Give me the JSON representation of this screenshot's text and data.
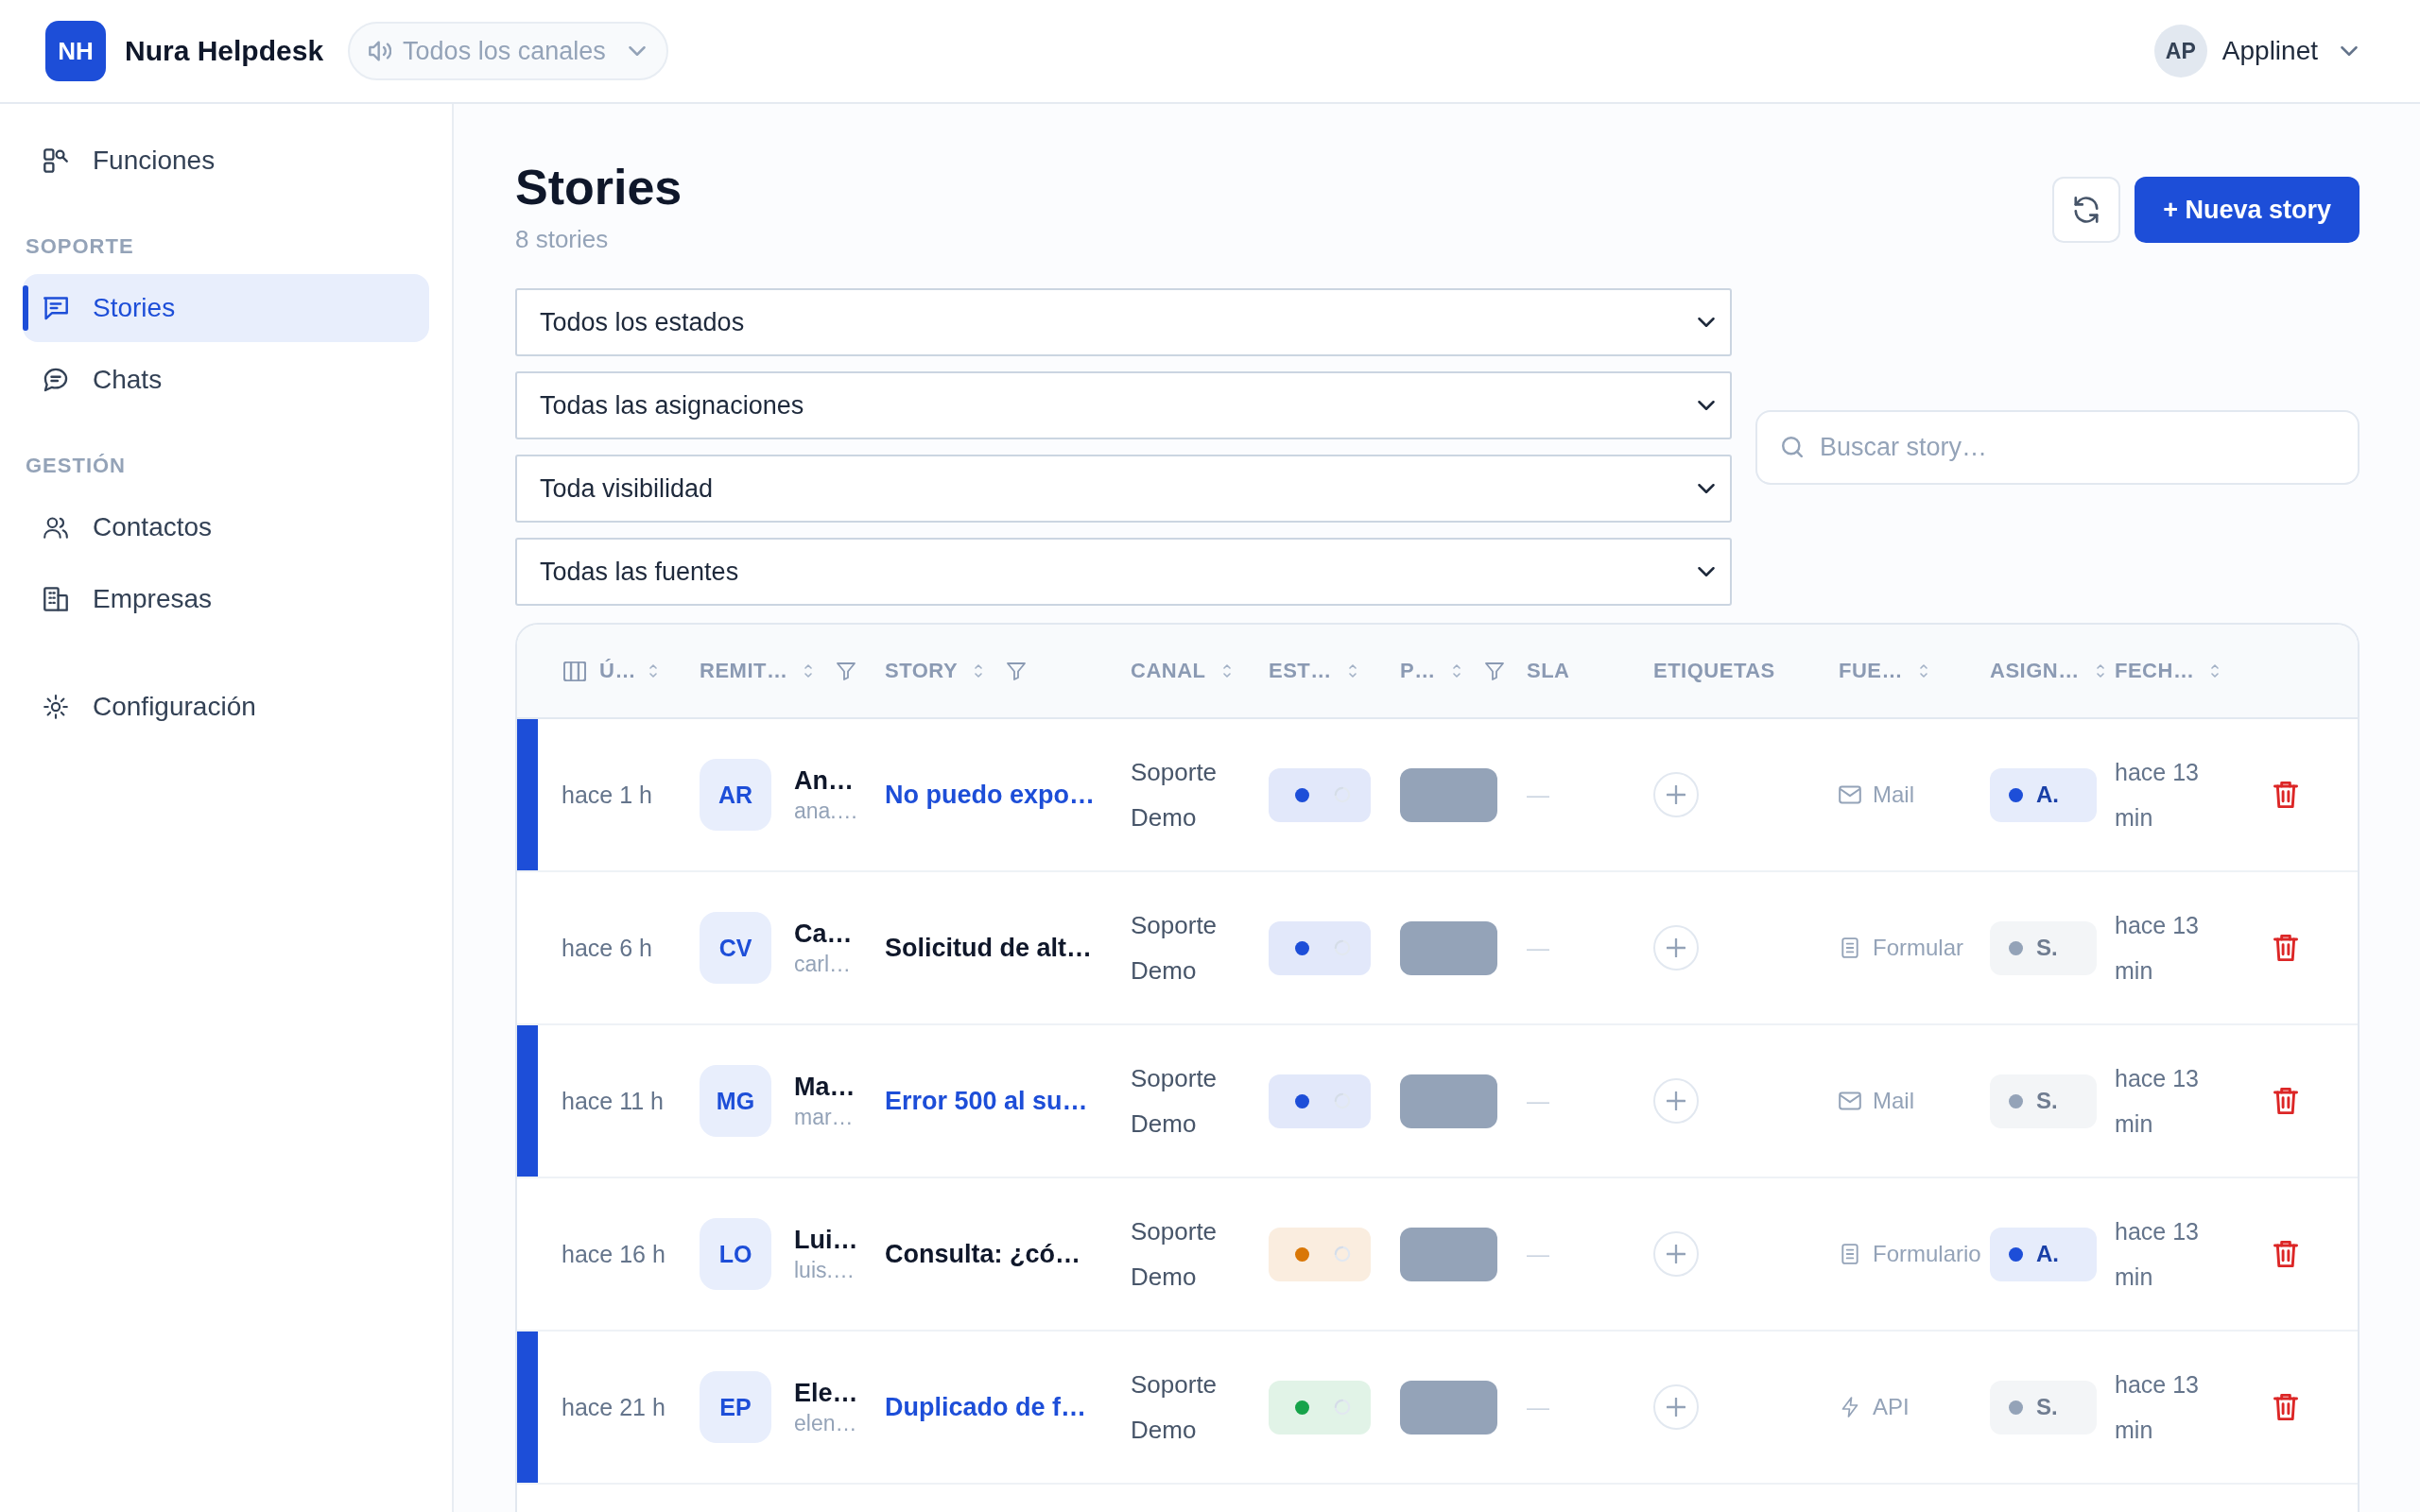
{
  "topbar": {
    "logo": "NH",
    "app_name": "Nura Helpdesk",
    "channel_select": "Todos los canales",
    "user": {
      "initials": "AP",
      "name": "Applinet"
    }
  },
  "sidebar": {
    "sections": [
      {
        "items": [
          {
            "kind": "features",
            "label": "Funciones",
            "selected": false
          }
        ]
      },
      {
        "title": "SOPORTE",
        "items": [
          {
            "kind": "stories",
            "label": "Stories",
            "selected": true
          },
          {
            "kind": "chats",
            "label": "Chats",
            "selected": false
          }
        ]
      },
      {
        "title": "GESTIÓN",
        "items": [
          {
            "kind": "contacts",
            "label": "Contactos",
            "selected": false
          },
          {
            "kind": "companies",
            "label": "Empresas",
            "selected": false
          }
        ]
      },
      {
        "items": [
          {
            "kind": "settings",
            "label": "Configuración",
            "selected": false
          }
        ]
      }
    ]
  },
  "page": {
    "title": "Stories",
    "subtitle": "8 stories",
    "new_button": "+ Nueva story"
  },
  "filters": {
    "selects": [
      "Todos los estados",
      "Todas las asignaciones",
      "Toda visibilidad",
      "Todas las fuentes"
    ],
    "search": {
      "placeholder": "Buscar story…"
    }
  },
  "table": {
    "columns": [
      {
        "label": "Ú…",
        "sortable": true,
        "filterable": false
      },
      {
        "label": "REMIT…",
        "sortable": true,
        "filterable": true
      },
      {
        "label": "STORY",
        "sortable": true,
        "filterable": true
      },
      {
        "label": "CANAL",
        "sortable": true,
        "filterable": false
      },
      {
        "label": "EST…",
        "sortable": true,
        "filterable": false
      },
      {
        "label": "P…",
        "sortable": true,
        "filterable": true
      },
      {
        "label": "SLA",
        "sortable": false,
        "filterable": false
      },
      {
        "label": "ETIQUETAS",
        "sortable": false,
        "filterable": false
      },
      {
        "label": "FUE…",
        "sortable": true,
        "filterable": false
      },
      {
        "label": "ASIGN…",
        "sortable": true,
        "filterable": false
      },
      {
        "label": "FECH…",
        "sortable": true,
        "filterable": false
      }
    ],
    "rows": [
      {
        "unread": true,
        "time": "hace 1 h",
        "sender": {
          "initials": "AR",
          "name": "An…",
          "email": "ana.…"
        },
        "story": "No puedo expo…",
        "channel": "Soporte Demo",
        "status": {
          "color": "#1d4ed8"
        },
        "sla": "—",
        "source": {
          "kind": "mail",
          "label": "Mail"
        },
        "assignee": {
          "label": "A.",
          "color": "#1d4ed8"
        },
        "date": "hace 13 min"
      },
      {
        "unread": false,
        "time": "hace 6 h",
        "sender": {
          "initials": "CV",
          "name": "Ca…",
          "email": "carl…"
        },
        "story": "Solicitud de alt…",
        "channel": "Soporte Demo",
        "status": {
          "color": "#1d4ed8"
        },
        "sla": "—",
        "source": {
          "kind": "form",
          "label": "Formular"
        },
        "assignee": {
          "label": "S.",
          "color": "#94a3b8"
        },
        "date": "hace 13 min"
      },
      {
        "unread": true,
        "time": "hace 11 h",
        "sender": {
          "initials": "MG",
          "name": "Ma…",
          "email": "mar…"
        },
        "story": "Error 500 al su…",
        "channel": "Soporte Demo",
        "status": {
          "color": "#1d4ed8"
        },
        "sla": "—",
        "source": {
          "kind": "mail",
          "label": "Mail"
        },
        "assignee": {
          "label": "S.",
          "color": "#94a3b8"
        },
        "date": "hace 13 min"
      },
      {
        "unread": false,
        "time": "hace 16 h",
        "sender": {
          "initials": "LO",
          "name": "Lui…",
          "email": "luis.…"
        },
        "story": "Consulta: ¿có…",
        "channel": "Soporte Demo",
        "status": {
          "color": "#d97706"
        },
        "sla": "—",
        "source": {
          "kind": "form",
          "label": "Formulario"
        },
        "assignee": {
          "label": "A.",
          "color": "#1d4ed8"
        },
        "date": "hace 13 min"
      },
      {
        "unread": true,
        "time": "hace 21 h",
        "sender": {
          "initials": "EP",
          "name": "Ele…",
          "email": "elen…"
        },
        "story": "Duplicado de f…",
        "channel": "Soporte Demo",
        "status": {
          "color": "#16a34a"
        },
        "sla": "—",
        "source": {
          "kind": "api",
          "label": "API"
        },
        "assignee": {
          "label": "S.",
          "color": "#94a3b8"
        },
        "date": "hace 13 min"
      }
    ]
  }
}
